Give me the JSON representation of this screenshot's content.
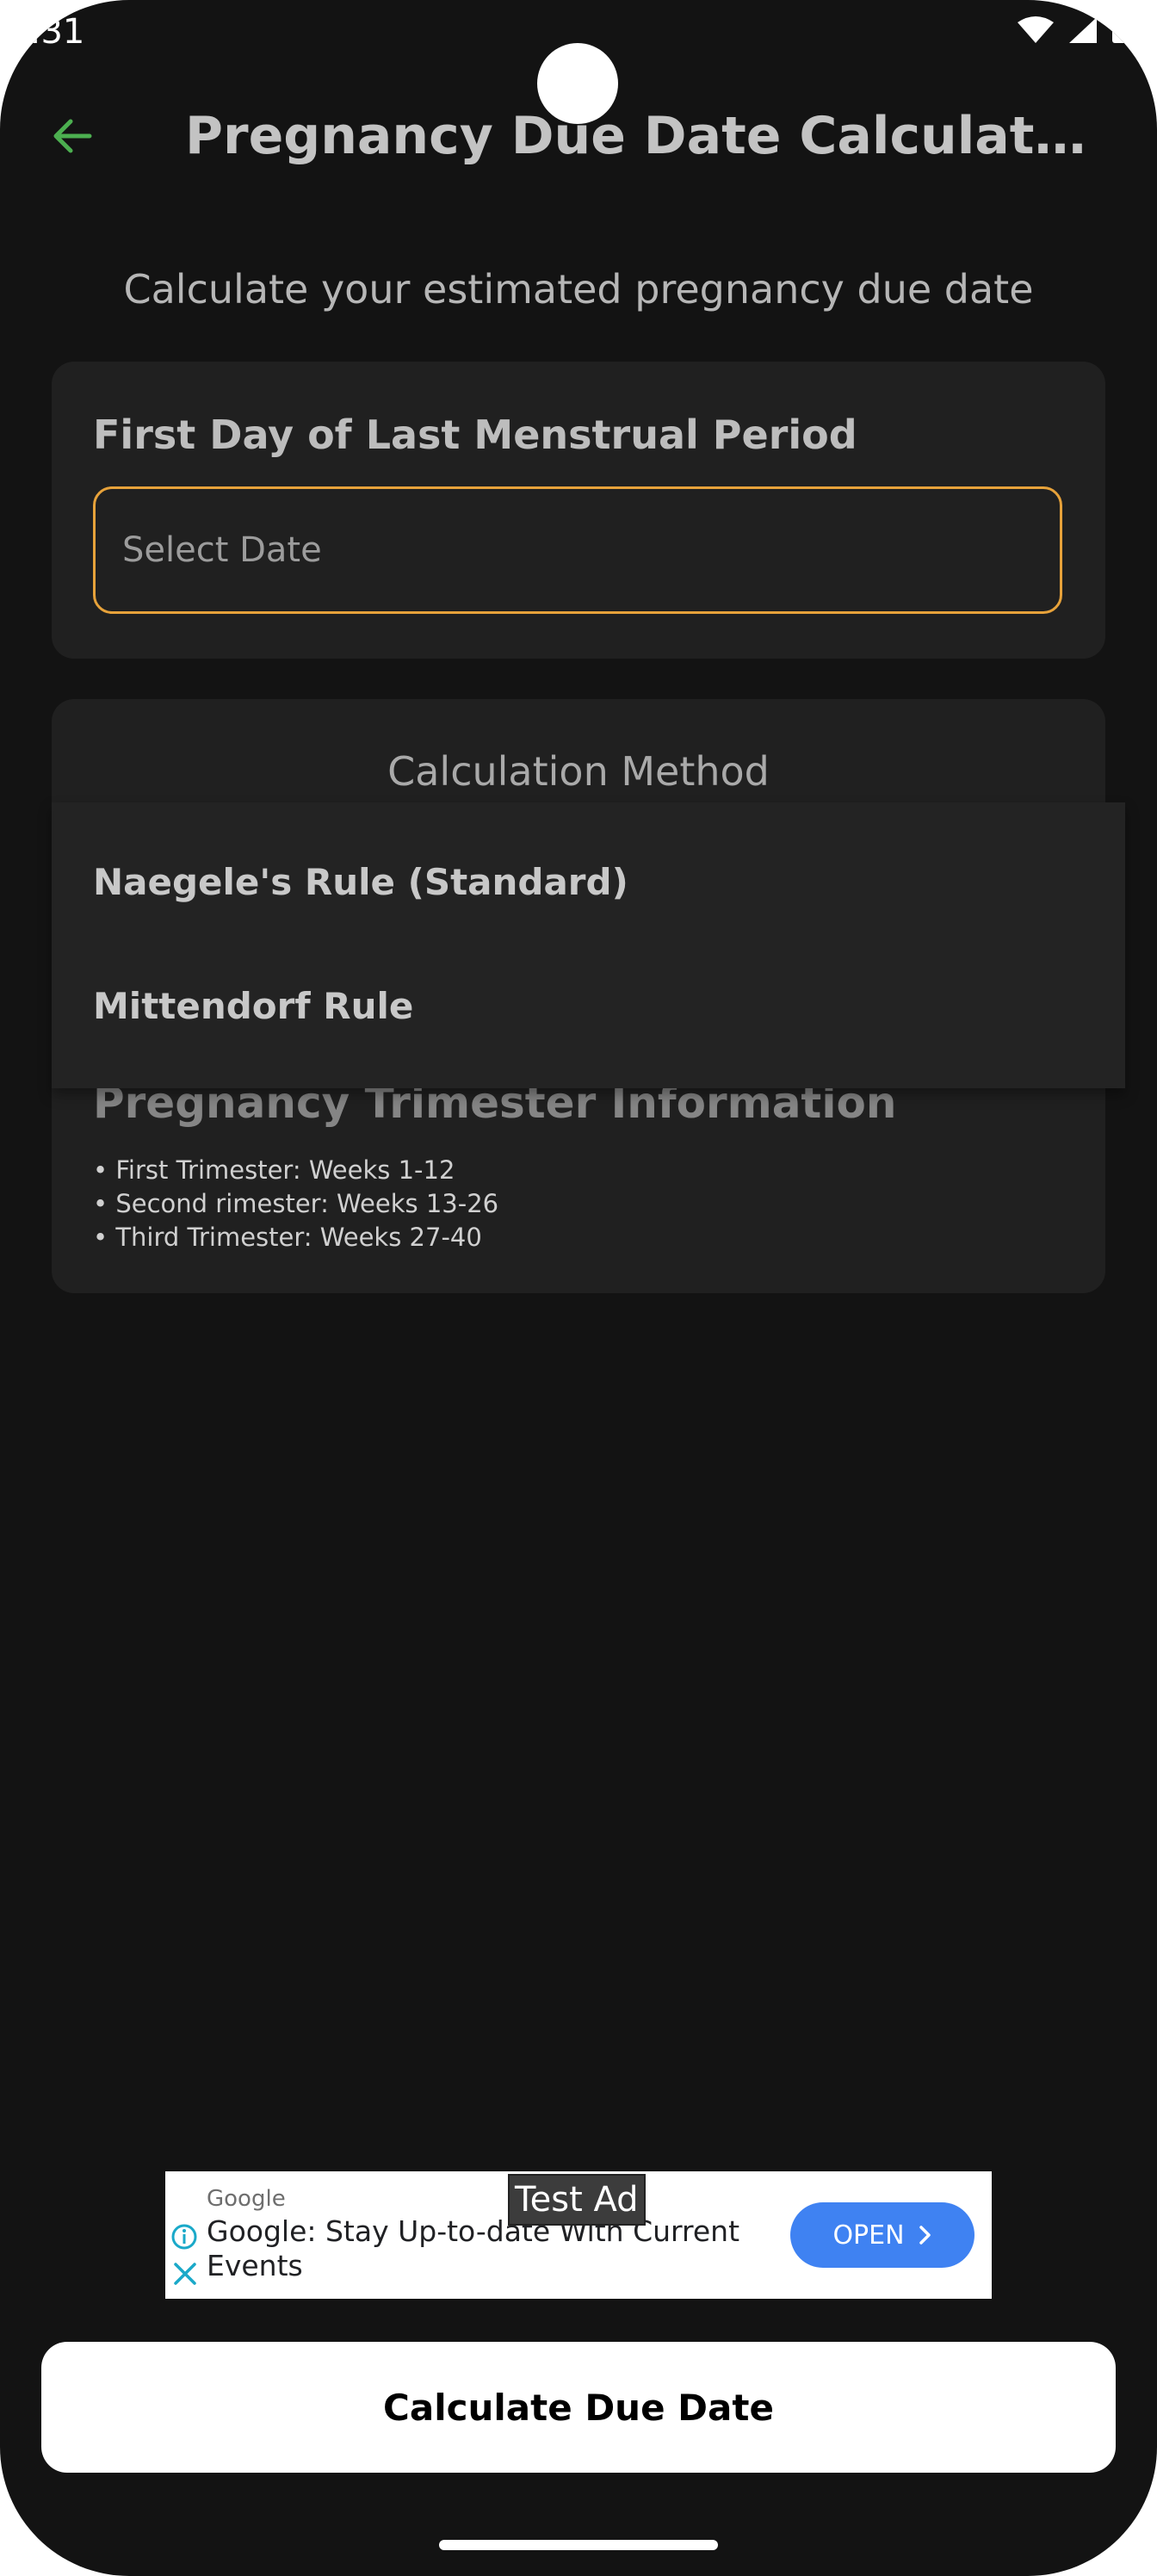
{
  "status_bar": {
    "time": ":31",
    "icons": [
      "wifi-icon",
      "signal-icon",
      "battery-icon"
    ]
  },
  "app_bar": {
    "back_icon": "arrow-left-icon",
    "title": "Pregnancy Due Date Calculat…"
  },
  "subtitle": "Calculate your estimated pregnancy due date",
  "lmp_card": {
    "label": "First Day of Last Menstrual Period",
    "placeholder": "Select Date"
  },
  "method_card": {
    "title": "Calculation Method",
    "options": [
      "Naegele's Rule (Standard)",
      "Mittendorf Rule"
    ]
  },
  "trimester_card": {
    "title": "Pregnancy Trimester Information",
    "items": [
      "• First Trimester: Weeks 1-12",
      "• Second rimester: Weeks 13-26",
      "• Third Trimester: Weeks 27-40"
    ]
  },
  "ad": {
    "label": "Test Ad",
    "brand": "Google",
    "headline": "Google: Stay Up-to-date With Current Events",
    "button": "OPEN"
  },
  "calculate_button": "Calculate Due Date",
  "colors": {
    "accent": "#4caf50",
    "field_border": "#e7a23a",
    "ad_button": "#3f82f2"
  }
}
